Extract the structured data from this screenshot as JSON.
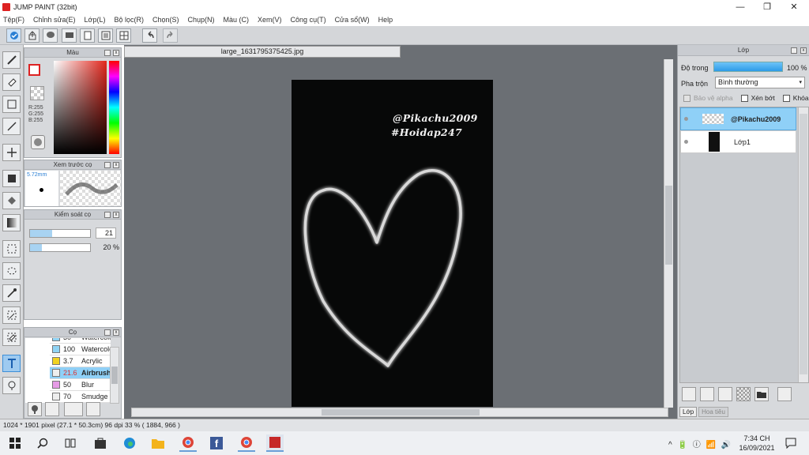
{
  "window": {
    "title": "JUMP PAINT (32bit)",
    "controls": [
      "—",
      "❐",
      "✕"
    ]
  },
  "menu": [
    "Tệp(F)",
    "Chỉnh sửa(E)",
    "Lớp(L)",
    "Bộ lọc(R)",
    "Chọn(S)",
    "Chụp(N)",
    "Màu (C)",
    "Xem(V)",
    "Công cụ(T)",
    "Cửa sổ(W)",
    "Help"
  ],
  "panels": {
    "color": {
      "title": "Màu",
      "rgb": {
        "r": "R:255",
        "g": "G:255",
        "b": "B:255"
      }
    },
    "brush_preview": {
      "title": "Xem trước cọ",
      "size": "5.72mm"
    },
    "brush_control": {
      "title": "Kiểm soát cọ",
      "size_value": "21",
      "opacity_value": "20 %",
      "size_fraction": 0.37,
      "opacity_fraction": 0.2
    },
    "brush": {
      "title": "Cọ",
      "items": [
        {
          "size": "30",
          "name": "Watercolor",
          "color": "#8fd3f4",
          "selected": false
        },
        {
          "size": "100",
          "name": "Watercolor (We",
          "color": "#8fd3f4",
          "selected": false
        },
        {
          "size": "3.7",
          "name": "Acrylic",
          "color": "#f1d21f",
          "selected": false
        },
        {
          "size": "21.6",
          "name": "Airbrush",
          "color": "#eeeeee",
          "selected": true
        },
        {
          "size": "50",
          "name": "Blur",
          "color": "#e69be6",
          "selected": false
        },
        {
          "size": "70",
          "name": "Smudge",
          "color": "#eeeeee",
          "selected": false
        }
      ]
    }
  },
  "document": {
    "tab": "large_1631795375425.jpg",
    "watermark_line1": "@Pikachu2009",
    "watermark_line2": "#Hoidap247"
  },
  "layers": {
    "title": "Lớp",
    "opacity_label": "Độ trong",
    "opacity_value": "100 %",
    "blend_label": "Pha trộn",
    "blend_value": "Bình thường",
    "checks": {
      "alpha": "Bảo vệ alpha",
      "clip": "Xén bớt",
      "lock": "Khóa"
    },
    "items": [
      {
        "name": "@Pikachu2009",
        "selected": true
      },
      {
        "name": "Lớp1",
        "selected": false
      }
    ],
    "tabs": [
      "Lớp",
      "Hoa tiêu"
    ]
  },
  "status": {
    "text": "1024 * 1901 pixel  (27.1 * 50.3cm)  96 dpi  33 %  ( 1884, 966 )"
  },
  "taskbar": {
    "time": "7:34 CH",
    "date": "16/09/2021",
    "tray": "^ 🔋 ⓘ 📶 🔊"
  }
}
